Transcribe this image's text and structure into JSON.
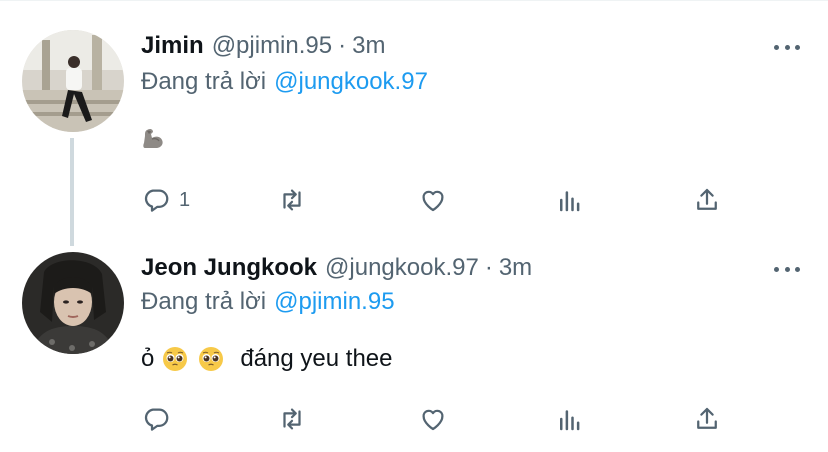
{
  "tweets": [
    {
      "name": "Jimin",
      "handle": "@pjimin.95",
      "time": "3m",
      "reply_prefix": "Đang trả lời",
      "reply_to": "@jungkook.97",
      "text": "",
      "emojis": [
        "flexed-biceps"
      ],
      "reply_count": "1"
    },
    {
      "name": "Jeon Jungkook",
      "handle": "@jungkook.97",
      "time": "3m",
      "reply_prefix": "Đang trả lời",
      "reply_to": "@pjimin.95",
      "text_prefix": "ỏ",
      "emojis": [
        "pleading-face",
        "pleading-face"
      ],
      "text": "đáng yeu thee",
      "reply_count": ""
    }
  ],
  "separator": "·",
  "colors": {
    "accent": "#1d9bf0",
    "secondary": "#536471",
    "thread_line": "#cfd9de"
  },
  "icons": [
    "reply-icon",
    "retweet-icon",
    "like-icon",
    "analytics-icon",
    "share-icon",
    "more-icon"
  ]
}
